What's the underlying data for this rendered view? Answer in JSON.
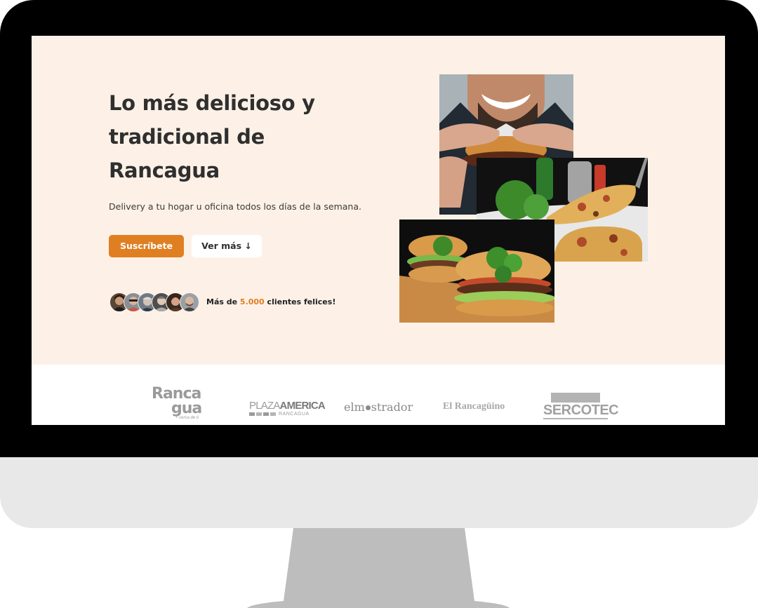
{
  "hero": {
    "title": "Lo más delicioso y tradicional de Rancagua",
    "subtitle": "Delivery a tu hogar u oficina todos los días de la semana.",
    "primary_button": "Suscríbete",
    "secondary_button": "Ver más ↓",
    "customers_prefix": "Más de ",
    "customers_count": "5.000",
    "customers_suffix": " clientes felices!",
    "avatars": [
      "customer-1",
      "customer-2",
      "customer-3",
      "customer-4",
      "customer-5",
      "customer-6"
    ]
  },
  "images": [
    "man-eating-burger",
    "pizza-slice",
    "burgers-on-board"
  ],
  "logos": {
    "rancagua_top": "Ranca",
    "rancagua_bottom": "gua",
    "rancagua_tag": "+ cerca de ti",
    "plaza_light": "PLAZA",
    "plaza_bold": "AMERICA",
    "plaza_sub": "RANCAGUA",
    "mostrador_1": "el",
    "mostrador_2": "m",
    "mostrador_3": "strador",
    "rancaguino": "El Rancagüino",
    "sercotec": "SERCOTEC"
  },
  "colors": {
    "accent": "#e07f22",
    "hero_bg": "#fdf1e7",
    "text_dark": "#2f2f2f",
    "logo_gray": "#9a9a9a"
  }
}
